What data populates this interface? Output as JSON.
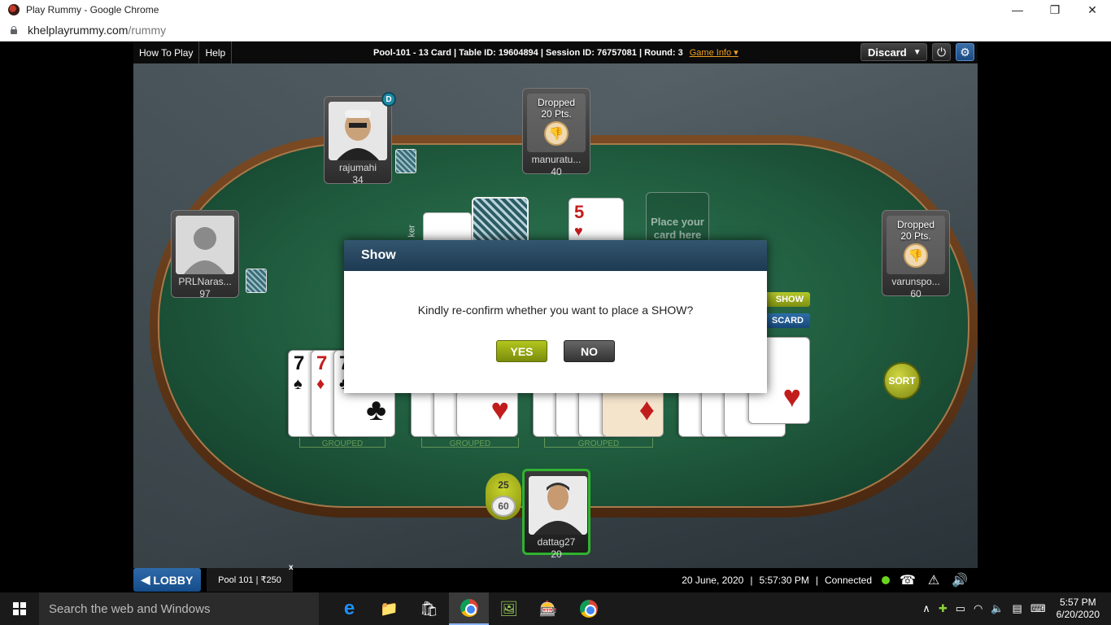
{
  "window": {
    "title": "Play Rummy - Google Chrome",
    "controls": [
      "—",
      "❐",
      "✕"
    ]
  },
  "browser": {
    "url_host": "khelplayrummy.com",
    "url_path": "/rummy"
  },
  "game_header": {
    "links": [
      "How To Play",
      "Help"
    ],
    "info": "Pool-101 - 13 Card |  Table ID: 19604894 |  Session ID: 76757081 |  Round: 3",
    "game_info_label": "Game Info",
    "discard_label": "Discard"
  },
  "players": {
    "top_left": {
      "name": "rajumahi",
      "score": "34",
      "dealer_badge": "D"
    },
    "top_center": {
      "name": "manuratu...",
      "score": "40",
      "dropped_label": "Dropped",
      "dropped_pts": "20 Pts."
    },
    "left": {
      "name": "PRLNaras...",
      "score": "97"
    },
    "right": {
      "name": "varunspo...",
      "score": "60",
      "dropped_label": "Dropped",
      "dropped_pts": "20 Pts."
    },
    "me": {
      "name": "dattag27",
      "score": "20"
    }
  },
  "center": {
    "joker_label": "ker",
    "open_card_rank": "5",
    "open_card_suit": "♥",
    "place_card_text": "Place your card here"
  },
  "tabs": {
    "show": "SHOW",
    "discard": "SCARD"
  },
  "sort_label": "SORT",
  "groups": [
    "GROUPED",
    "GROUPED",
    "GROUPED"
  ],
  "score_bubble": {
    "current": "25",
    "max": "60"
  },
  "modal": {
    "title": "Show",
    "message": "Kindly re-confirm whether you want to place a SHOW?",
    "yes": "YES",
    "no": "NO"
  },
  "status": {
    "lobby": "LOBBY",
    "pool_tab": "Pool 101 | ₹250",
    "pool_close": "x",
    "date": "20 June, 2020",
    "time": "5:57:30 PM",
    "connection": "Connected"
  },
  "taskbar": {
    "search_placeholder": "Search the web and Windows",
    "clock_time": "5:57 PM",
    "clock_date": "6/20/2020"
  },
  "colors": {
    "accent_yes": "#9bb015",
    "modal_header": "#2a4a64",
    "connected_dot": "#6bd41f"
  }
}
